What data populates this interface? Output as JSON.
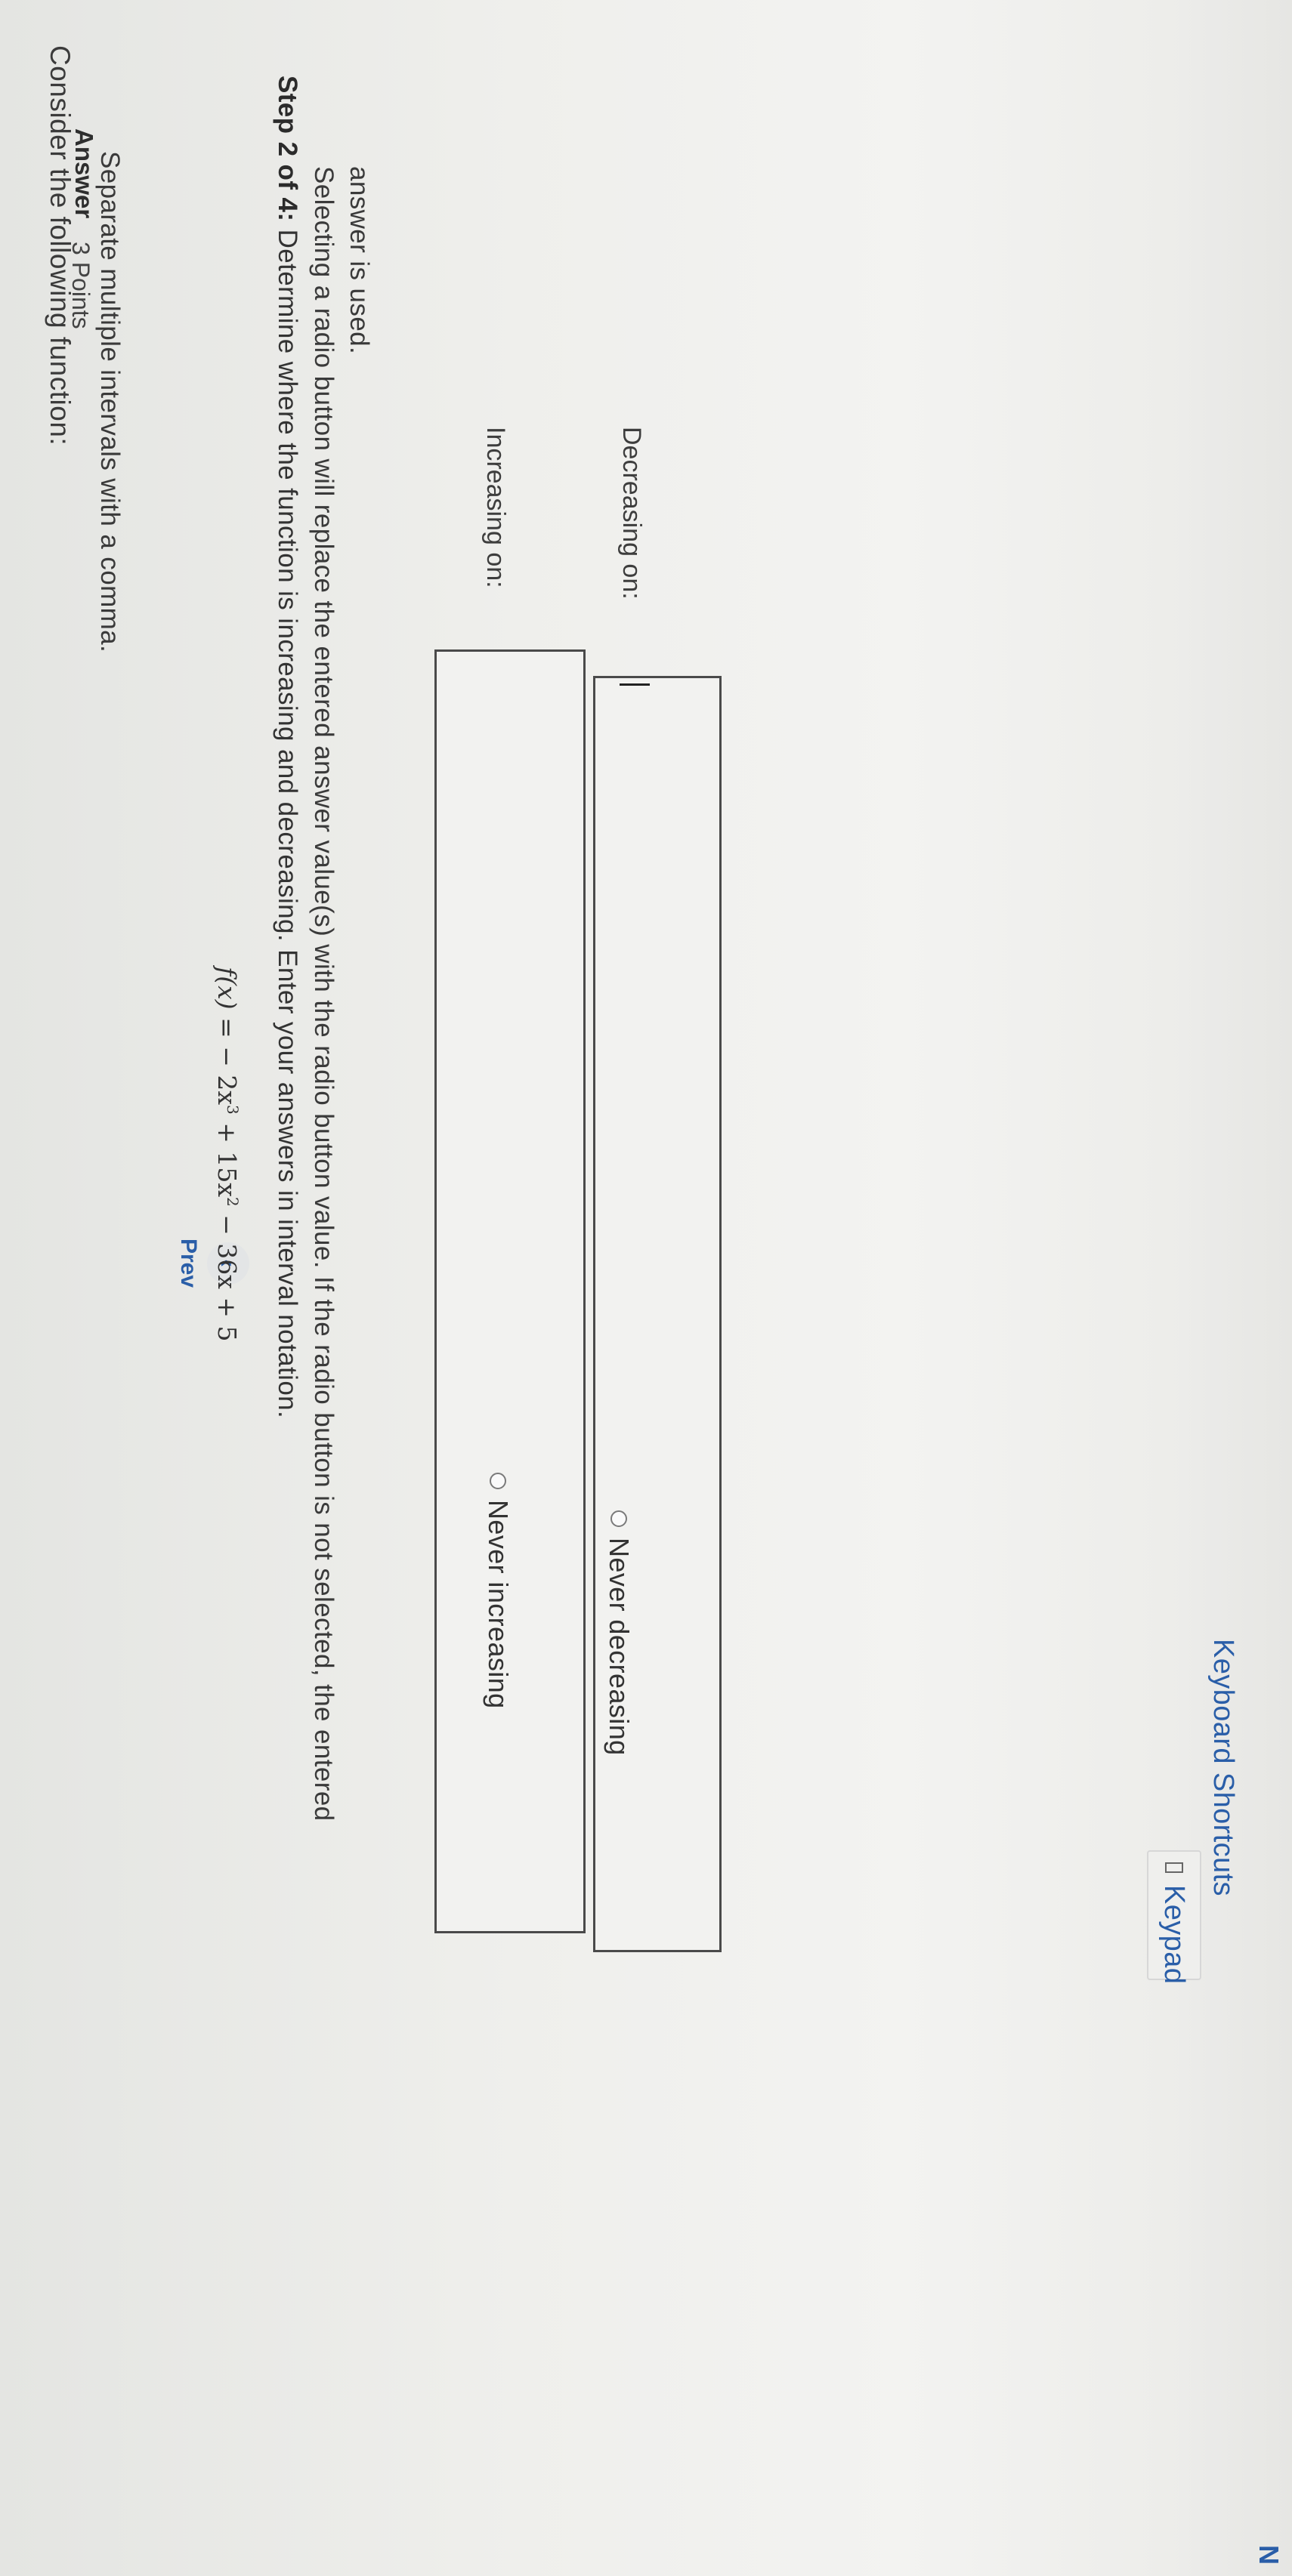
{
  "question": {
    "intro": "Consider the following function:",
    "formula": {
      "lhs": "f(x) = ",
      "term1": "− 2x",
      "term1_exp": "3",
      "term2": " + 15x",
      "term2_exp": "2",
      "term3": " − 36x + 5"
    },
    "step_bold": "Step 2 of 4:",
    "step_text": " Determine where the function is increasing and decreasing. Enter your answers in interval notation."
  },
  "answer": {
    "label": "Answer",
    "points": "3 Points",
    "instruction_1": "Separate multiple intervals with a comma.",
    "instruction_2a": "Selecting a radio button will replace the entered answer value(s) with the radio button value. If the radio button is not selected, the entered",
    "instruction_2b": "answer is used."
  },
  "fields": {
    "increasing_label": "Increasing on:",
    "increasing_value": "",
    "decreasing_label": "Decreasing on:",
    "decreasing_value": ""
  },
  "radios": {
    "never_increasing": "Never increasing",
    "never_decreasing": "Never decreasing"
  },
  "toolbar": {
    "keypad_label": "Keypad",
    "shortcuts_label": "Keyboard Shortcuts"
  },
  "nav": {
    "prev_label": "Prev",
    "prev_icon": "chevron-left-icon",
    "next_label": "N"
  },
  "colors": {
    "link": "#2a5ea8",
    "text": "#333333",
    "box_border": "#4a4a4a"
  }
}
